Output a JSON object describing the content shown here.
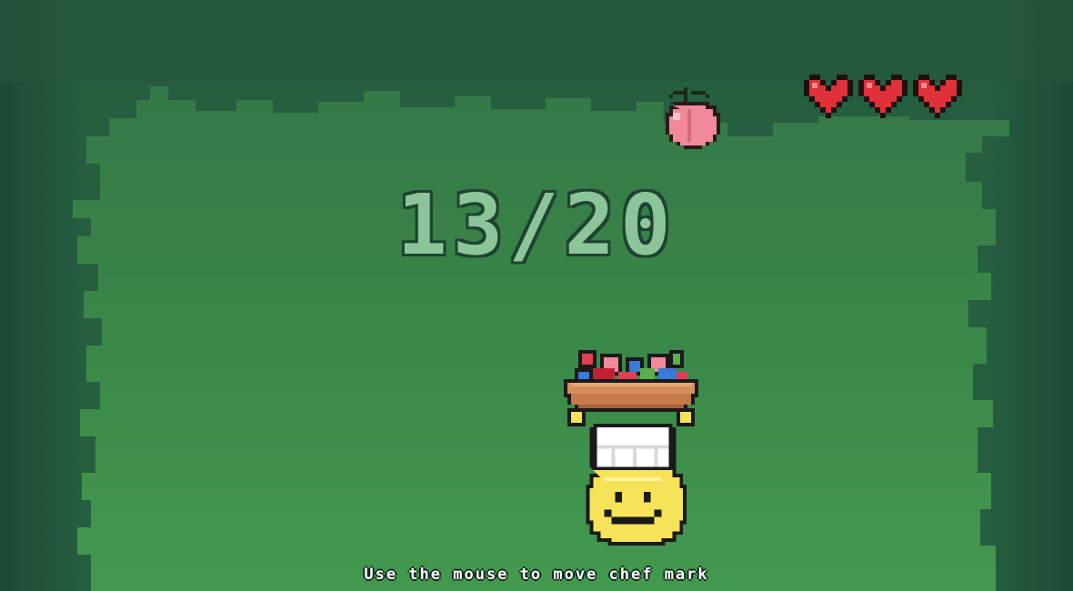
{
  "hud": {
    "score": "13/20",
    "lives": 3,
    "lives_max": 3
  },
  "instruction": "Use the mouse to move chef mark",
  "falling_item": "peach",
  "icons": {
    "life": "heart-icon",
    "fruit": "peach-icon",
    "basket": "fruit-basket-icon",
    "chef": "chef-smiley-icon"
  },
  "colors": {
    "forest_dark": "#21533b",
    "clearing": "#3d8a4a",
    "score_fill": "#8dc59a",
    "score_outline": "#1e4330",
    "heart": "#e0303a",
    "peach": "#f08a9a",
    "chef_face": "#f6e35a",
    "chef_hat": "#ffffff",
    "basket": "#d58f5e"
  }
}
